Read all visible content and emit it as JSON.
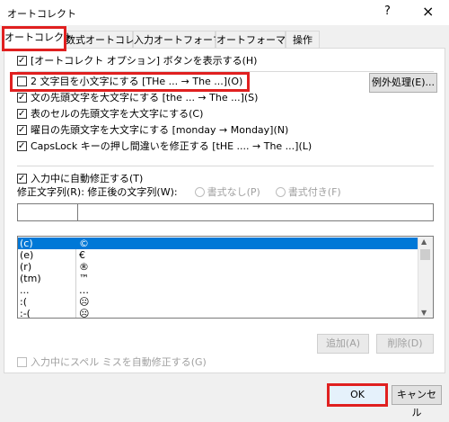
{
  "window": {
    "title": "オートコレクト",
    "help": "?",
    "close": "×"
  },
  "tabs": [
    {
      "label": "オートコレクト"
    },
    {
      "label": "数式オートコレクト"
    },
    {
      "label": "入力オートフォーマット"
    },
    {
      "label": "オートフォーマット"
    },
    {
      "label": "操作"
    }
  ],
  "options": {
    "show_buttons": "[オートコレクト オプション] ボタンを表示する(H)",
    "two_initial": "2 文字目を小文字にする [THe ... → The ...](O)",
    "first_letter": "文の先頭文字を大文字にする [the ... → The ...](S)",
    "table_cells": "表のセルの先頭文字を大文字にする(C)",
    "day_names": "曜日の先頭文字を大文字にする [monday → Monday](N)",
    "caps_lock": "CapsLock キーの押し間違いを修正する [tHE .... → The ...](L)"
  },
  "exceptions_button": "例外処理(E)...",
  "replace": {
    "checkbox": "入力中に自動修正する(T)",
    "label": "修正文字列(R): 修正後の文字列(W):",
    "plain": "書式なし(P)",
    "formatted": "書式付き(F)"
  },
  "entries": [
    {
      "from": "(c)",
      "to": "©"
    },
    {
      "from": "(e)",
      "to": "€"
    },
    {
      "from": "(r)",
      "to": "®"
    },
    {
      "from": "(tm)",
      "to": "™"
    },
    {
      "from": "...",
      "to": "…"
    },
    {
      "from": ":(",
      "to": "☹"
    },
    {
      "from": ":-(",
      "to": "☹"
    }
  ],
  "add_button": "追加(A)",
  "delete_button": "削除(D)",
  "spell_checkbox": "入力中にスペル ミスを自動修正する(G)",
  "ok_button": "OK",
  "cancel_button": "キャンセル",
  "colors": {
    "highlight": "#e02020",
    "selection": "#0078d7"
  }
}
